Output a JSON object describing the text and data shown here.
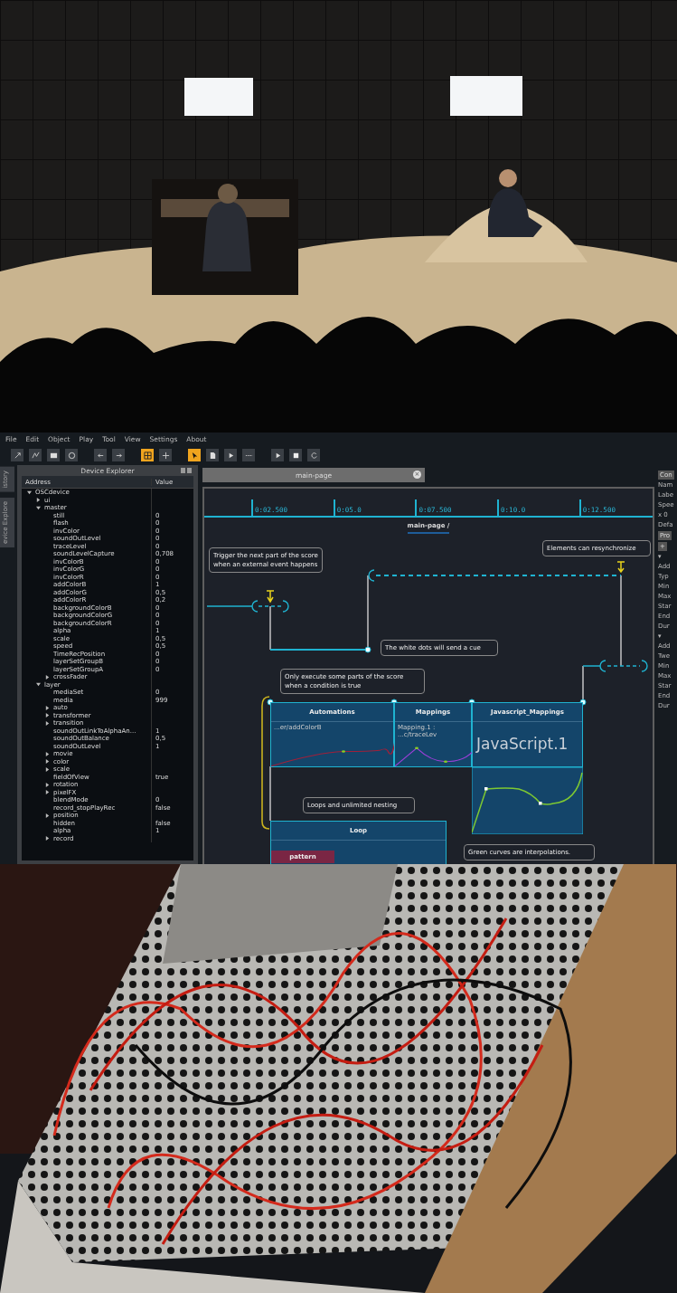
{
  "app": {
    "menu": [
      "File",
      "Edit",
      "Object",
      "Play",
      "Tool",
      "View",
      "Settings",
      "About"
    ],
    "toolbar": [
      {
        "kind": "expand",
        "selected": false
      },
      {
        "kind": "nodes",
        "selected": false
      },
      {
        "kind": "square",
        "selected": false
      },
      {
        "kind": "circle",
        "selected": false
      },
      {
        "kind": "left",
        "selected": false
      },
      {
        "kind": "right",
        "selected": false
      },
      {
        "kind": "grid",
        "selected": true
      },
      {
        "kind": "move",
        "selected": false
      },
      {
        "kind": "cursor",
        "selected": true
      },
      {
        "kind": "page",
        "selected": false
      },
      {
        "kind": "play",
        "selected": false
      },
      {
        "kind": "dots",
        "selected": false
      },
      {
        "kind": "play",
        "selected": false
      },
      {
        "kind": "stop",
        "selected": false
      },
      {
        "kind": "refresh",
        "selected": false
      }
    ],
    "side_tabs": [
      "istory",
      "evice Explore"
    ],
    "explorer": {
      "title": "Device Explorer",
      "columns": [
        "Address",
        "Value"
      ],
      "tree": [
        {
          "name": "OSCdevice",
          "expanded": true,
          "children": [
            {
              "name": "ui",
              "expanded": false
            },
            {
              "name": "master",
              "expanded": true,
              "children": [
                {
                  "name": "still",
                  "value": "0"
                },
                {
                  "name": "flash",
                  "value": "0"
                },
                {
                  "name": "invColor",
                  "value": "0"
                },
                {
                  "name": "soundOutLevel",
                  "value": "0"
                },
                {
                  "name": "traceLevel",
                  "value": "0"
                },
                {
                  "name": "soundLevelCapture",
                  "value": "0,708"
                },
                {
                  "name": "invColorB",
                  "value": "0"
                },
                {
                  "name": "invColorG",
                  "value": "0"
                },
                {
                  "name": "invColorR",
                  "value": "0"
                },
                {
                  "name": "addColorB",
                  "value": "1"
                },
                {
                  "name": "addColorG",
                  "value": "0,5"
                },
                {
                  "name": "addColorR",
                  "value": "0,2"
                },
                {
                  "name": "backgroundColorB",
                  "value": "0"
                },
                {
                  "name": "backgroundColorG",
                  "value": "0"
                },
                {
                  "name": "backgroundColorR",
                  "value": "0"
                },
                {
                  "name": "alpha",
                  "value": "1"
                },
                {
                  "name": "scale",
                  "value": "0,5"
                },
                {
                  "name": "speed",
                  "value": "0,5"
                },
                {
                  "name": "TimeRecPosition",
                  "value": "0"
                },
                {
                  "name": "layerSetGroupB",
                  "value": "0"
                },
                {
                  "name": "layerSetGroupA",
                  "value": "0"
                },
                {
                  "name": "crossFader",
                  "expanded": false
                }
              ]
            },
            {
              "name": "layer",
              "expanded": true,
              "children": [
                {
                  "name": "mediaSet",
                  "value": "0"
                },
                {
                  "name": "media",
                  "value": "999"
                },
                {
                  "name": "auto",
                  "expanded": false
                },
                {
                  "name": "transformer",
                  "expanded": false
                },
                {
                  "name": "transition",
                  "expanded": false
                },
                {
                  "name": "soundOutLinkToAlphaAn...",
                  "value": "1"
                },
                {
                  "name": "soundOutBalance",
                  "value": "0,5"
                },
                {
                  "name": "soundOutLevel",
                  "value": "1"
                },
                {
                  "name": "movie",
                  "expanded": false
                },
                {
                  "name": "color",
                  "expanded": false
                },
                {
                  "name": "scale",
                  "expanded": false
                },
                {
                  "name": "fieldOfView",
                  "value": "true"
                },
                {
                  "name": "rotation",
                  "expanded": false
                },
                {
                  "name": "pixelFX",
                  "expanded": false
                },
                {
                  "name": "blendMode",
                  "value": "0"
                },
                {
                  "name": "record_stopPlayRec",
                  "value": "false"
                },
                {
                  "name": "position",
                  "expanded": false
                },
                {
                  "name": "hidden",
                  "value": "false"
                },
                {
                  "name": "alpha",
                  "value": "1"
                },
                {
                  "name": "record",
                  "expanded": false
                }
              ]
            }
          ]
        }
      ]
    },
    "document_tab": {
      "label": "main-page",
      "close": "×"
    },
    "ruler": [
      "0:02.500",
      "0:05.0",
      "0:07.500",
      "0:10.0",
      "0:12.500"
    ],
    "scenario_title": "main-page /",
    "comments": [
      "Trigger the next part of the score when an external event happens",
      "Elements can resynchronize",
      "The white dots will send a cue",
      "Only execute some parts of the score when a condition is true",
      "Loops and unlimited nesting",
      "Green curves are interpolations."
    ],
    "processes": [
      {
        "title": "Automations",
        "content": "...er/addColorB"
      },
      {
        "title": "Mappings",
        "content": "Mapping.1 :  ...c/traceLev"
      },
      {
        "title": "Javascript_Mappings",
        "content": "JavaScript.1"
      }
    ],
    "loop": {
      "title": "Loop",
      "pattern": "pattern"
    },
    "inspector": [
      {
        "kind": "button",
        "text": "Con"
      },
      {
        "kind": "label",
        "text": "Nam"
      },
      {
        "kind": "label",
        "text": "Labe"
      },
      {
        "kind": "label",
        "text": "Spee"
      },
      {
        "kind": "label",
        "text": "x 0"
      },
      {
        "kind": "label",
        "text": "Defa"
      },
      {
        "kind": "button",
        "text": "Pro"
      },
      {
        "kind": "button",
        "text": "+"
      },
      {
        "kind": "label",
        "text": "▾"
      },
      {
        "kind": "label",
        "text": "Add"
      },
      {
        "kind": "label",
        "text": "Typ"
      },
      {
        "kind": "label",
        "text": "Min"
      },
      {
        "kind": "label",
        "text": "Max"
      },
      {
        "kind": "label",
        "text": "Star"
      },
      {
        "kind": "label",
        "text": "End"
      },
      {
        "kind": "label",
        "text": "Dur"
      },
      {
        "kind": "label",
        "text": "▾"
      },
      {
        "kind": "label",
        "text": "Add"
      },
      {
        "kind": "label",
        "text": "Twe"
      },
      {
        "kind": "label",
        "text": "Min"
      },
      {
        "kind": "label",
        "text": "Max"
      },
      {
        "kind": "label",
        "text": "Star"
      },
      {
        "kind": "label",
        "text": "End"
      },
      {
        "kind": "label",
        "text": "Dur"
      }
    ]
  }
}
